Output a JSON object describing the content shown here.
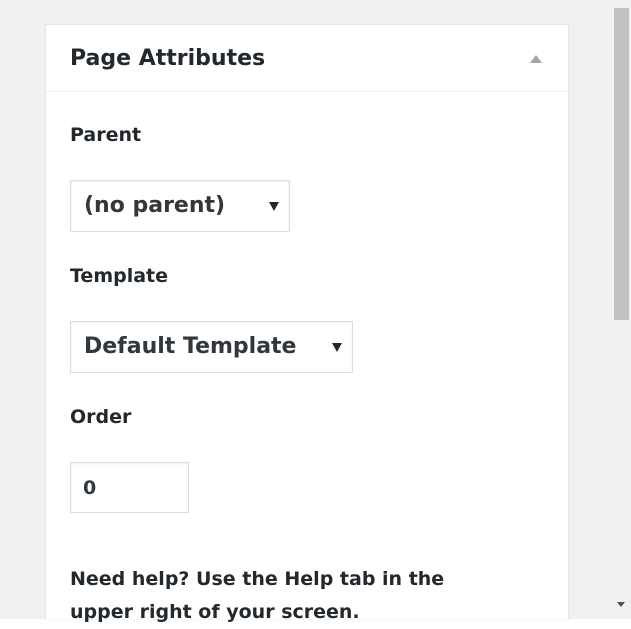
{
  "page_attributes": {
    "title": "Page Attributes",
    "toggle_icon": "triangle-up-icon",
    "parent": {
      "label": "Parent",
      "selected": "(no parent)"
    },
    "template": {
      "label": "Template",
      "selected": "Default Template"
    },
    "order": {
      "label": "Order",
      "value": "0"
    },
    "help": {
      "line1": "Need help? Use the Help tab in the",
      "line2": "upper right of your screen."
    }
  },
  "colors": {
    "panel_background": "#ffffff",
    "page_background": "#f1f1f1",
    "text": "#23282d",
    "border": "#dddddd",
    "scrollbar_thumb": "#c1c1c1"
  }
}
